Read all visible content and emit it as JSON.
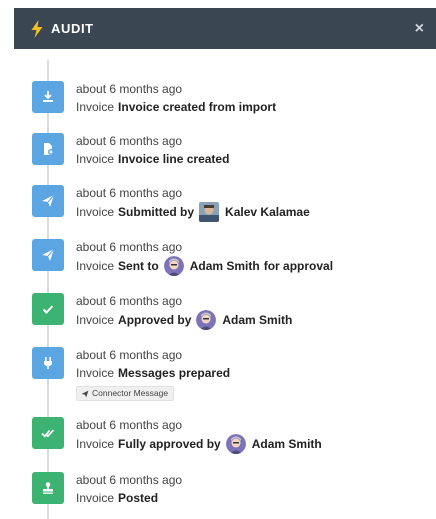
{
  "header": {
    "title": "AUDIT",
    "close": "×",
    "bolt_color": "#f3c023"
  },
  "colors": {
    "blue": "#5aa5e2",
    "green": "#3cb371",
    "header_bg": "#3b4653"
  },
  "entries": [
    {
      "time": "about 6 months ago",
      "prefix": "Invoice",
      "action": "Invoice created from import",
      "icon": "download-icon",
      "color": "blue"
    },
    {
      "time": "about 6 months ago",
      "prefix": "Invoice",
      "action": "Invoice line created",
      "icon": "document-plus-icon",
      "color": "blue"
    },
    {
      "time": "about 6 months ago",
      "prefix": "Invoice",
      "action": "Submitted by",
      "user": "Kalev Kalamae",
      "icon": "paper-plane-icon",
      "color": "blue"
    },
    {
      "time": "about 6 months ago",
      "prefix": "Invoice",
      "action": "Sent to",
      "user": "Adam Smith",
      "suffix": "for approval",
      "icon": "paper-plane-icon",
      "color": "blue"
    },
    {
      "time": "about 6 months ago",
      "prefix": "Invoice",
      "action": "Approved by",
      "user": "Adam Smith",
      "icon": "check-icon",
      "color": "green"
    },
    {
      "time": "about 6 months ago",
      "prefix": "Invoice",
      "action": "Messages prepared",
      "tag": "Connector Message",
      "icon": "plug-icon",
      "color": "blue"
    },
    {
      "time": "about 6 months ago",
      "prefix": "Invoice",
      "action": "Fully approved by",
      "user": "Adam Smith",
      "icon": "double-check-icon",
      "color": "green"
    },
    {
      "time": "about 6 months ago",
      "prefix": "Invoice",
      "action": "Posted",
      "icon": "stamp-icon",
      "color": "green"
    }
  ]
}
